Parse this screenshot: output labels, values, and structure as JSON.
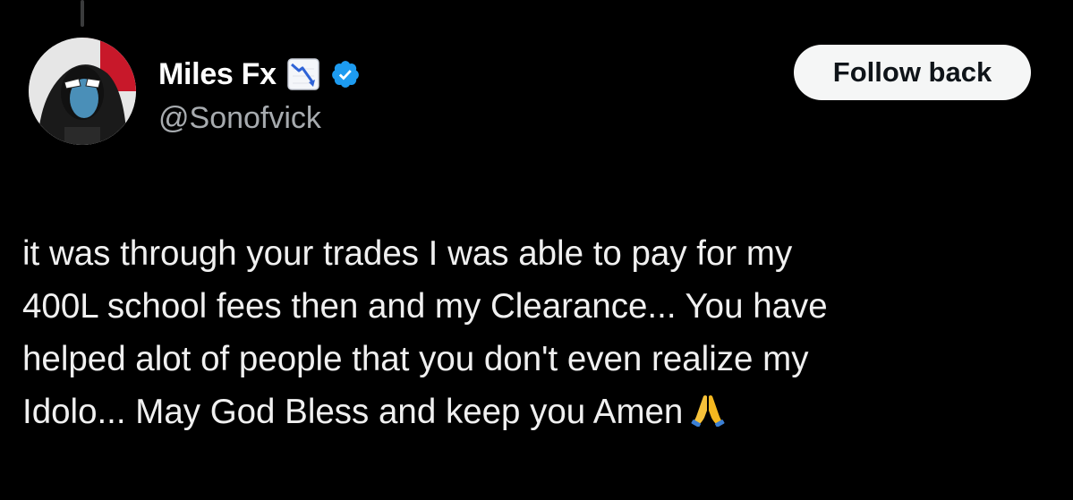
{
  "author": {
    "display_name": "Miles Fx",
    "handle": "@Sonofvick",
    "name_emoji": "chart-decreasing-icon",
    "verified": true,
    "verified_color": "#1d9bf0"
  },
  "actions": {
    "follow_label": "Follow back"
  },
  "post": {
    "lines": [
      "it was through your trades I was able to pay for my",
      "400L school fees then and my Clearance... You have",
      "helped alot of people that you don't even realize my",
      "Idolo... May God Bless and keep you Amen"
    ],
    "trailing_emoji": "folded-hands-icon"
  },
  "colors": {
    "background": "#000000",
    "text_primary": "#ffffff",
    "text_secondary": "#a7abaf",
    "button_bg": "#f5f6f6",
    "button_text": "#0f1419"
  }
}
